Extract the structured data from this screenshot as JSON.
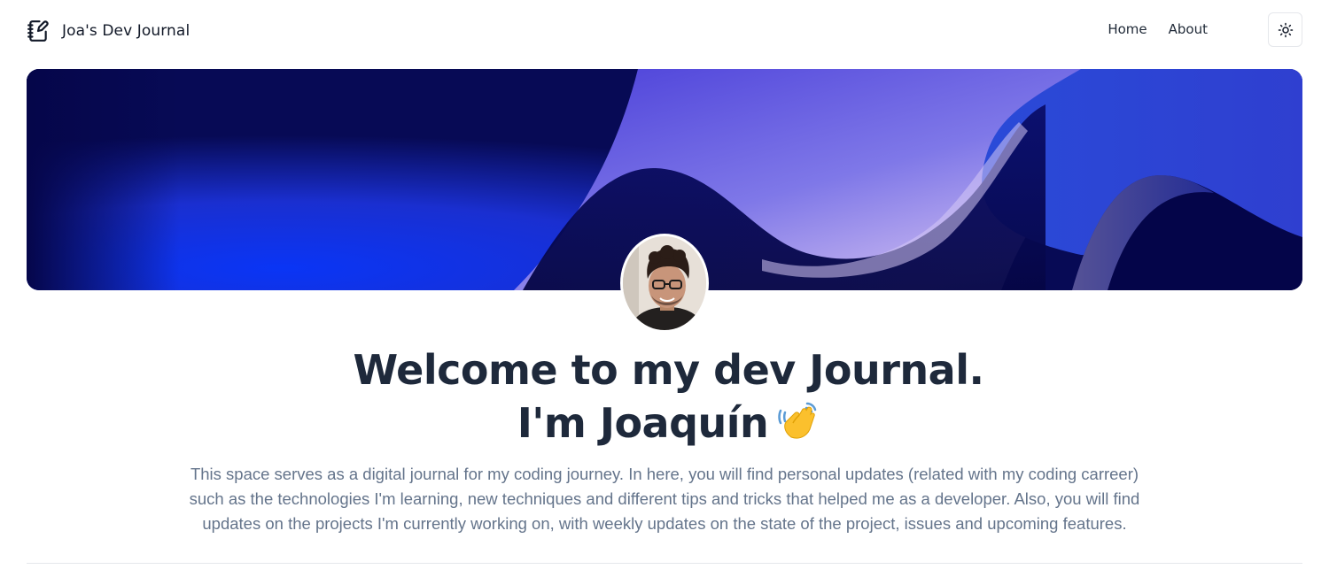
{
  "header": {
    "brand_icon": "notebook-pen-icon",
    "brand_name": "Joa's Dev Journal",
    "nav": [
      {
        "label": "Home"
      },
      {
        "label": "About"
      }
    ],
    "theme_toggle_icon": "sun-icon"
  },
  "hero": {
    "banner_colors": [
      "#070a55",
      "#1336e6",
      "#a89de8",
      "#030448"
    ],
    "avatar_alt": "Profile photo",
    "title_line1": "Welcome to my dev Journal.",
    "title_line2": "I'm Joaquín",
    "title_emoji_icon": "waving-hand-icon",
    "intro": "This space serves as a digital journal for my coding journey. In here, you will find personal updates (related with my coding carreer) such as the technologies I'm learning, new techniques and different tips and tricks that helped me as a developer. Also, you will find updates on the projects I'm currently working on, with weekly updates on the state of the project, issues and upcoming features."
  }
}
